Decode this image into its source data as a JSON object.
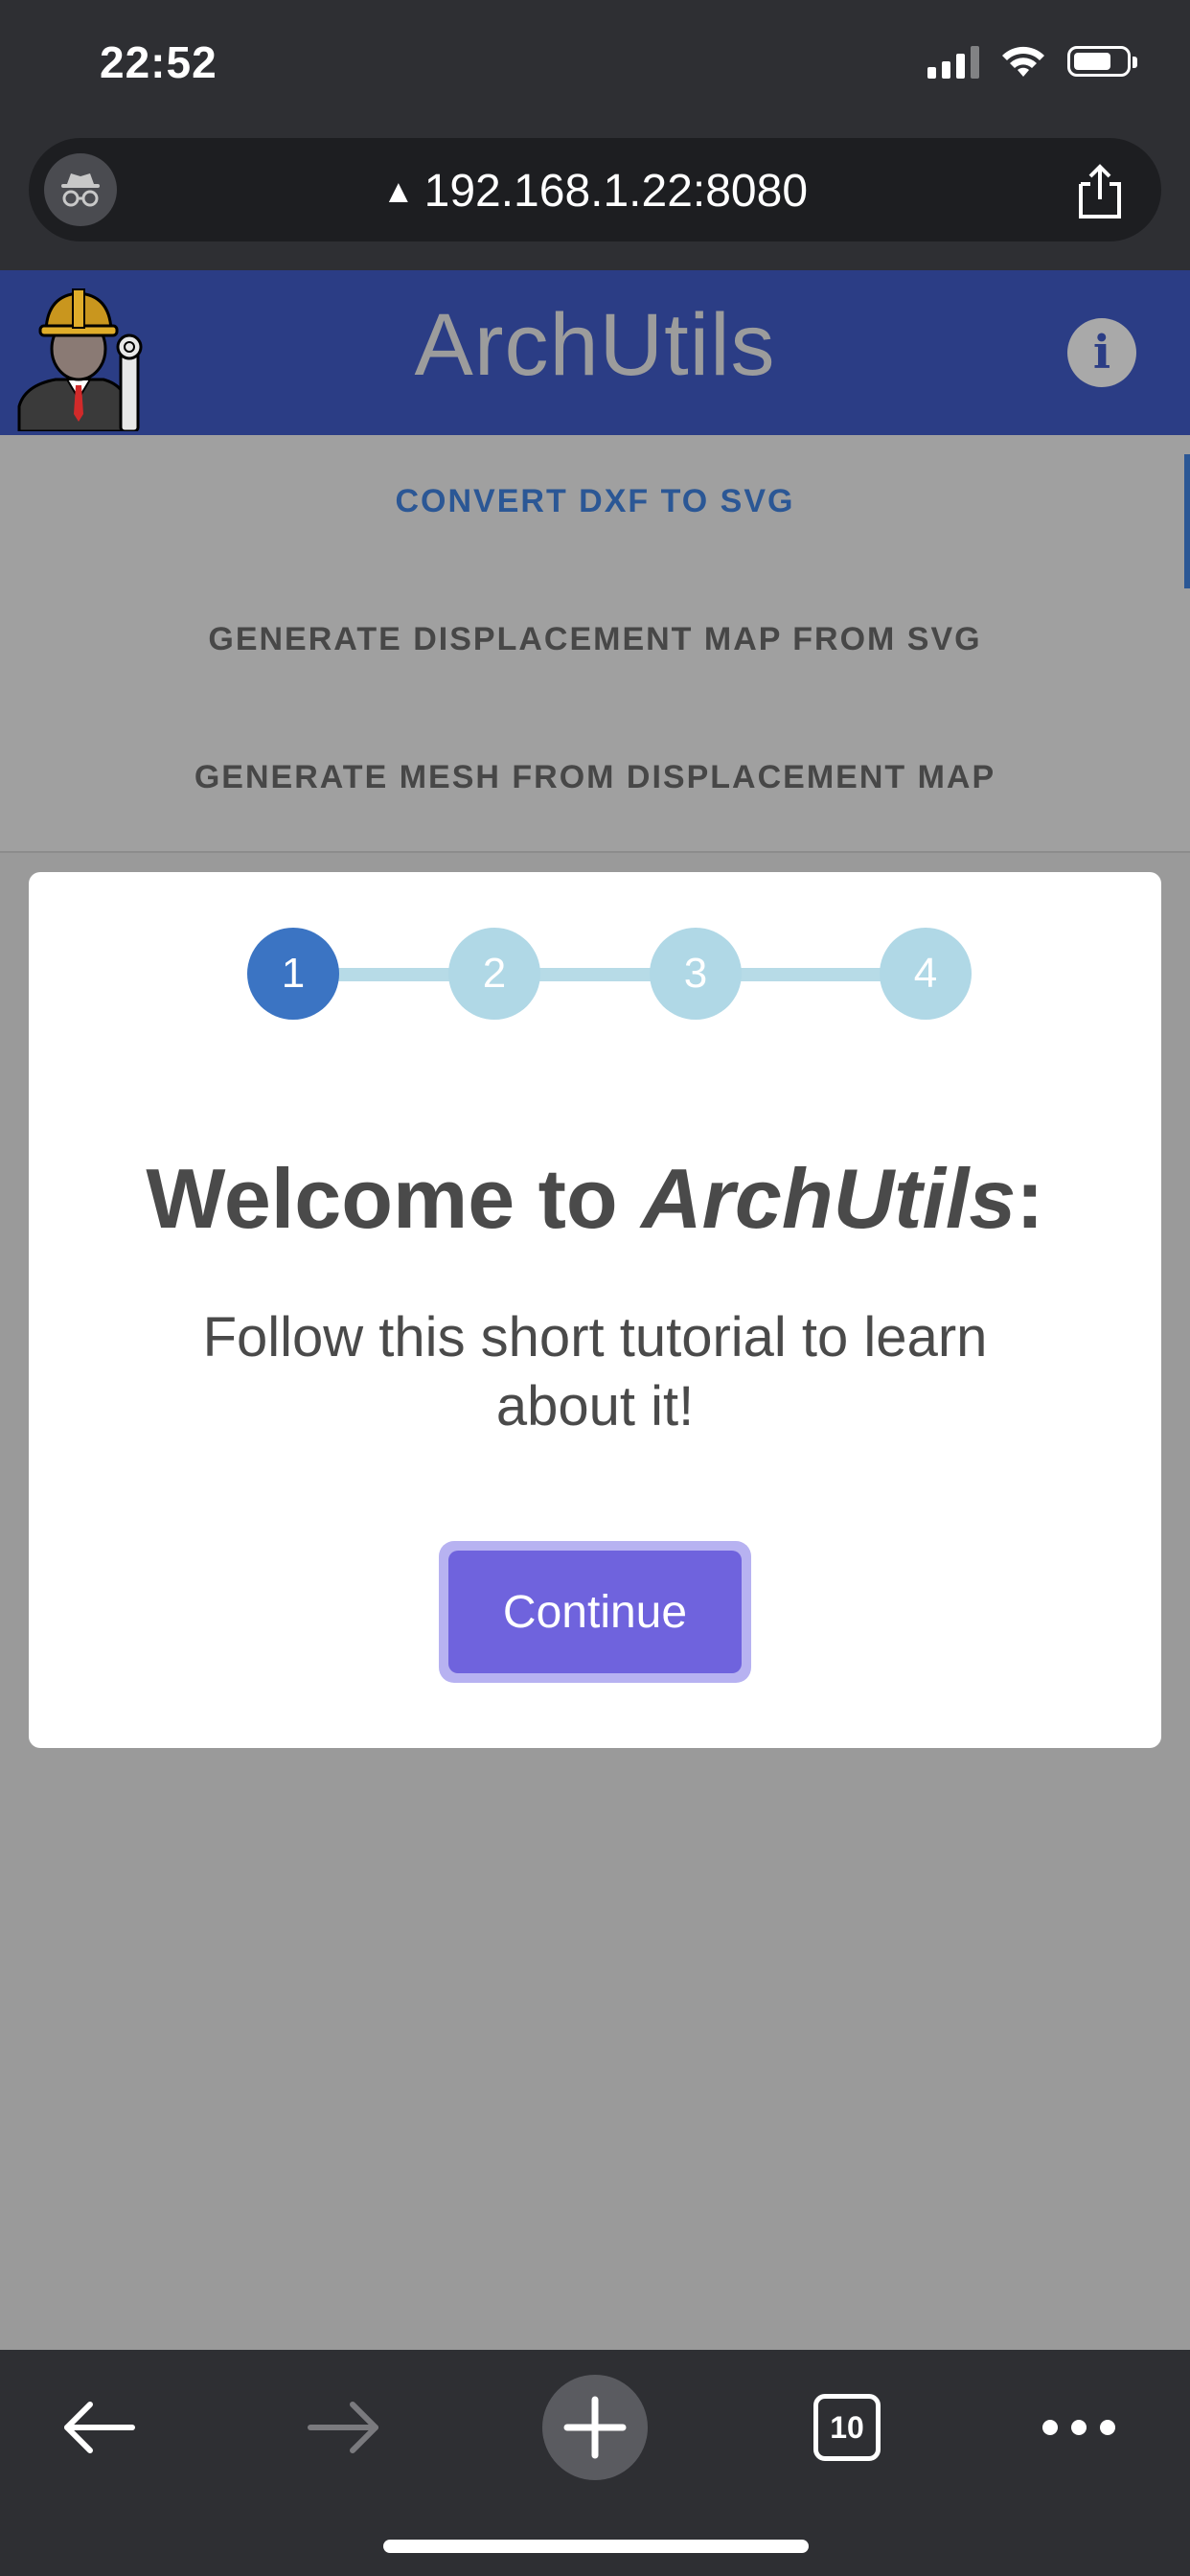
{
  "status_bar": {
    "time": "22:52"
  },
  "browser": {
    "url": "192.168.1.22:8080",
    "tabs_count": "10"
  },
  "app": {
    "title": "ArchUtils",
    "info_label": "i",
    "nav": [
      {
        "label": "CONVERT DXF TO SVG"
      },
      {
        "label": "GENERATE DISPLACEMENT MAP FROM SVG"
      },
      {
        "label": "GENERATE MESH FROM DISPLACEMENT MAP"
      }
    ]
  },
  "modal": {
    "steps": [
      "1",
      "2",
      "3",
      "4"
    ],
    "active_step": 1,
    "welcome_prefix": "Welcome to ",
    "welcome_app": "ArchUtils",
    "welcome_suffix": ":",
    "subtitle": "Follow this short tutorial to learn about it!",
    "continue_label": "Continue"
  },
  "colors": {
    "header": "#2b3d85",
    "active_tab": "#2b5795",
    "step_active": "#3b74c3",
    "step_inactive": "#b0d8e6",
    "button": "#6f63dd"
  },
  "icons": {
    "incognito": "incognito-icon",
    "warning": "warning-icon",
    "share": "share-icon",
    "back": "back-arrow-icon",
    "forward": "forward-arrow-icon",
    "new_tab": "plus-icon",
    "tabs": "tabs-icon",
    "more": "more-dots-icon"
  }
}
